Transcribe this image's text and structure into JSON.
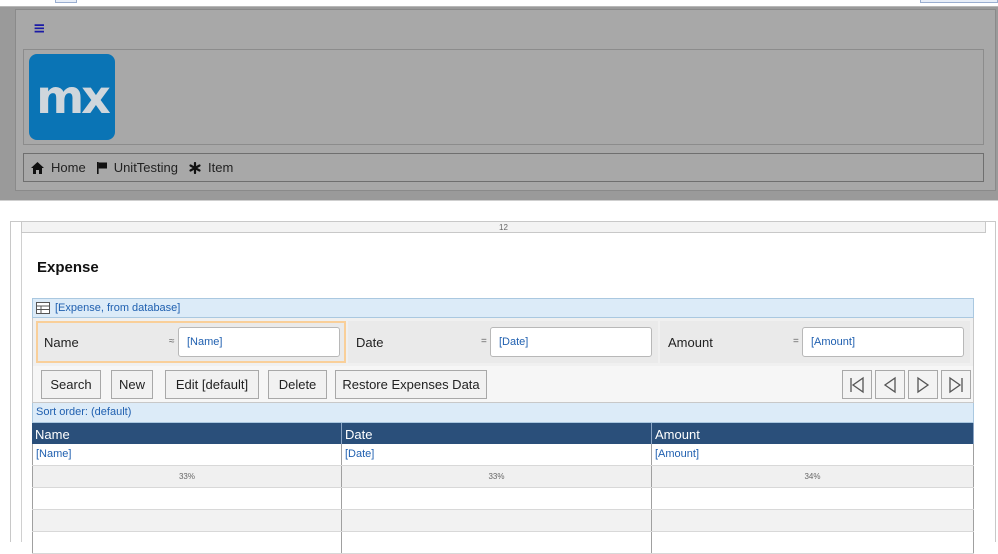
{
  "header": {
    "logo_text": "mx",
    "breadcrumb": [
      {
        "icon": "home-icon",
        "label": "Home"
      },
      {
        "icon": "flag-icon",
        "label": "UnitTesting"
      },
      {
        "icon": "asterisk-icon",
        "label": "Item"
      }
    ]
  },
  "layout_ruler": "12",
  "page_title": "Expense",
  "datasource": "[Expense, from database]",
  "search_fields": [
    {
      "label": "Name",
      "operator": "≈",
      "value": "[Name]"
    },
    {
      "label": "Date",
      "operator": "=",
      "value": "[Date]"
    },
    {
      "label": "Amount",
      "operator": "=",
      "value": "[Amount]"
    }
  ],
  "buttons": {
    "search": "Search",
    "new": "New",
    "edit": "Edit [default]",
    "delete": "Delete",
    "restore": "Restore Expenses Data"
  },
  "sort_order": "Sort order: (default)",
  "grid": {
    "columns": [
      "Name",
      "Date",
      "Amount"
    ],
    "bindings": [
      "[Name]",
      "[Date]",
      "[Amount]"
    ],
    "widths": [
      "33%",
      "33%",
      "34%"
    ]
  },
  "colors": {
    "logo": "#0a74b5",
    "grid_header": "#2a4f7a",
    "datasource_bar": "#dcebf8",
    "focus_border": "#f9cf99"
  }
}
